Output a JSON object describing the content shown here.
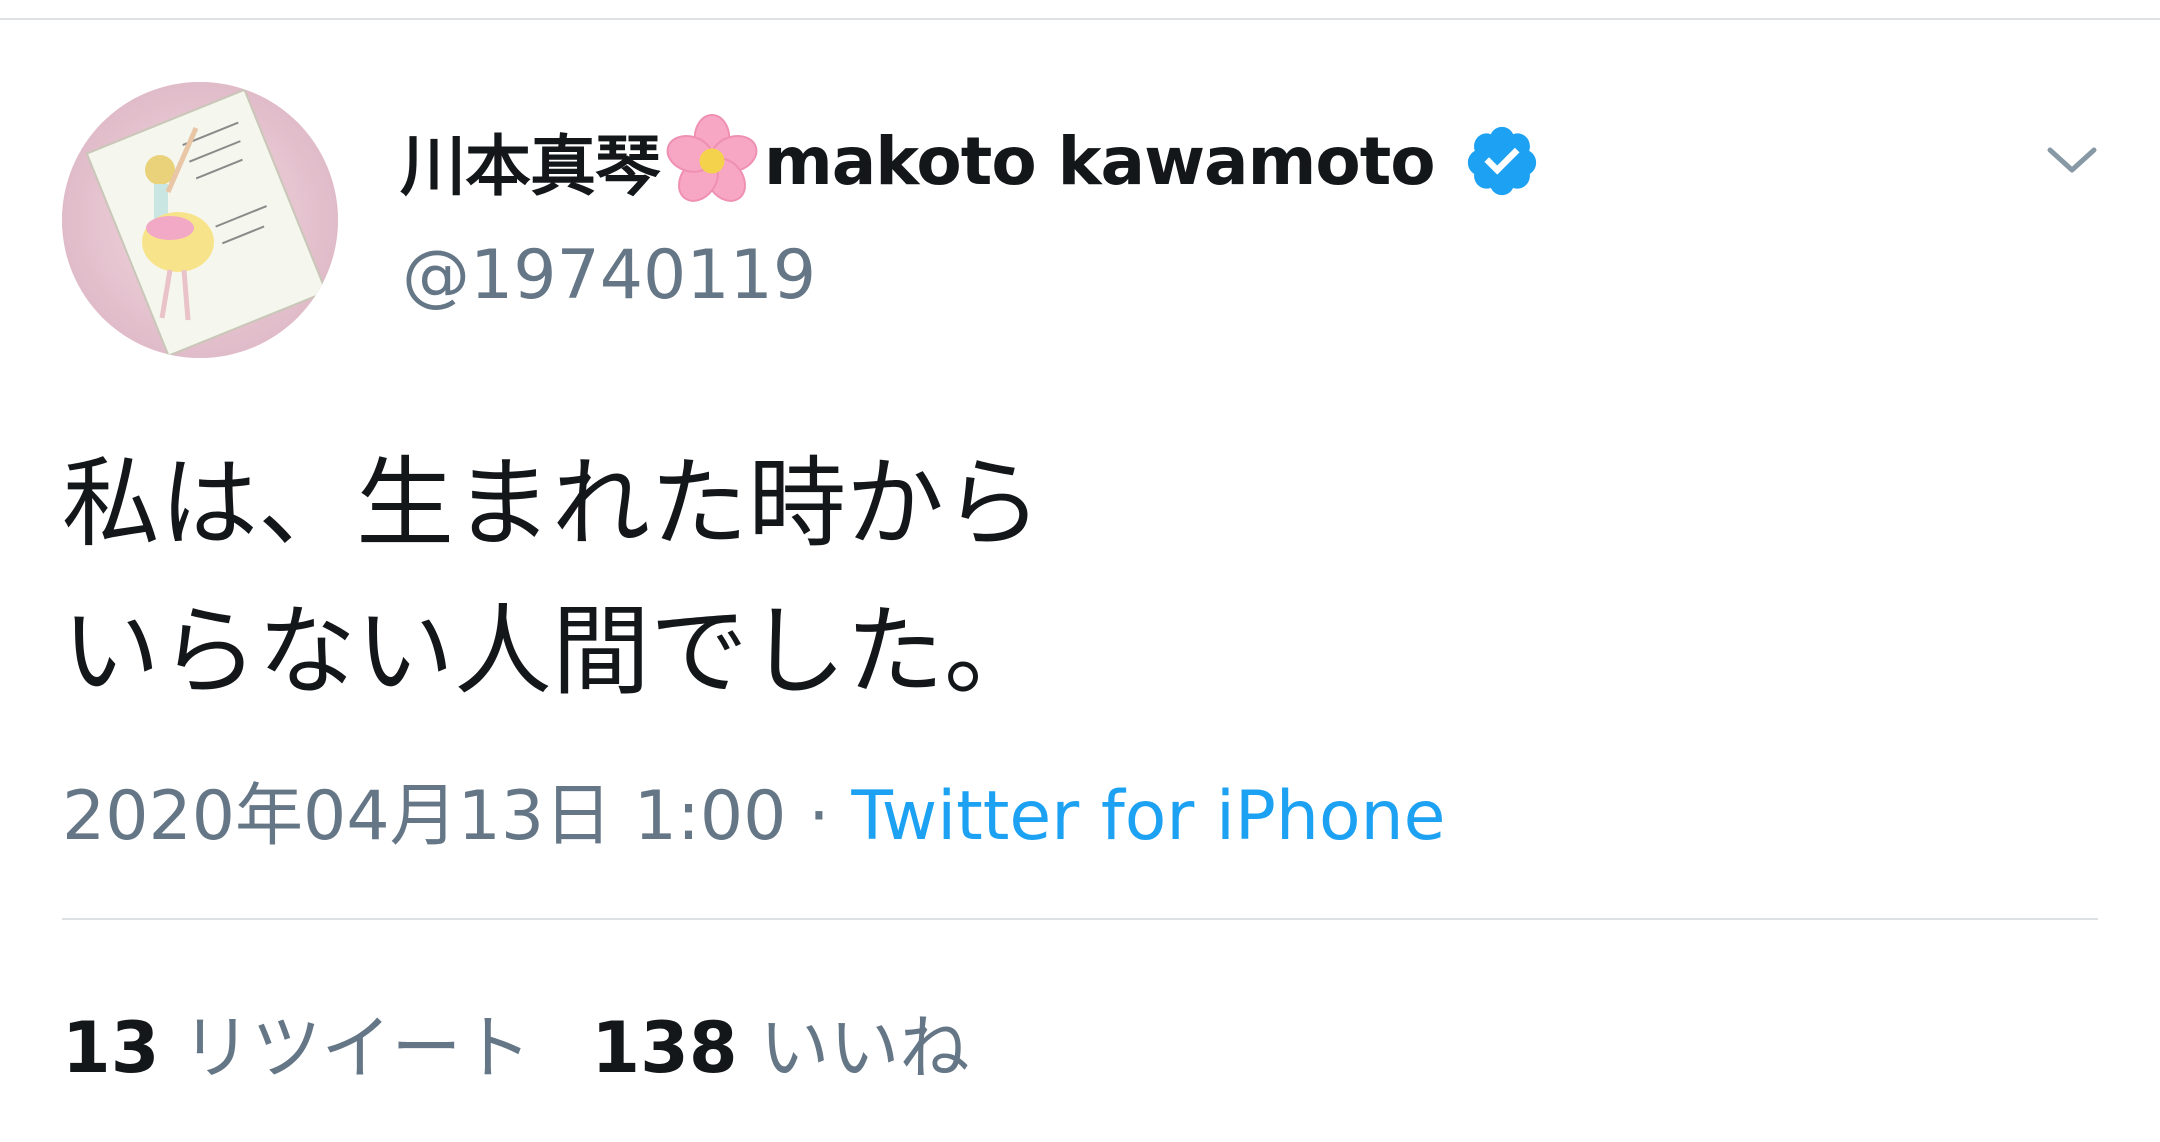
{
  "tweet": {
    "author": {
      "display_name_before_flower": "川本真琴",
      "display_name_after_flower": "makoto kawamoto",
      "handle": "@19740119",
      "verified": true
    },
    "text_lines": [
      "私は、生まれた時から",
      "いらない人間でした。"
    ],
    "timestamp": "2020年04月13日 1:00",
    "separator": "·",
    "source": "Twitter for iPhone",
    "stats": {
      "retweets_count": "13",
      "retweets_label": "リツイート",
      "likes_count": "138",
      "likes_label": "いいね"
    }
  },
  "icons": {
    "name_flower": "cherry-blossom-emoji",
    "verified_badge": "verified-badge-icon",
    "menu": "chevron-down-icon"
  },
  "colors": {
    "text_primary": "#14171a",
    "text_secondary": "#657786",
    "link_blue": "#1da1f2",
    "divider": "#dde1e4",
    "verified_blue": "#1da1f2",
    "flower_pink": "#f7a6c4"
  }
}
